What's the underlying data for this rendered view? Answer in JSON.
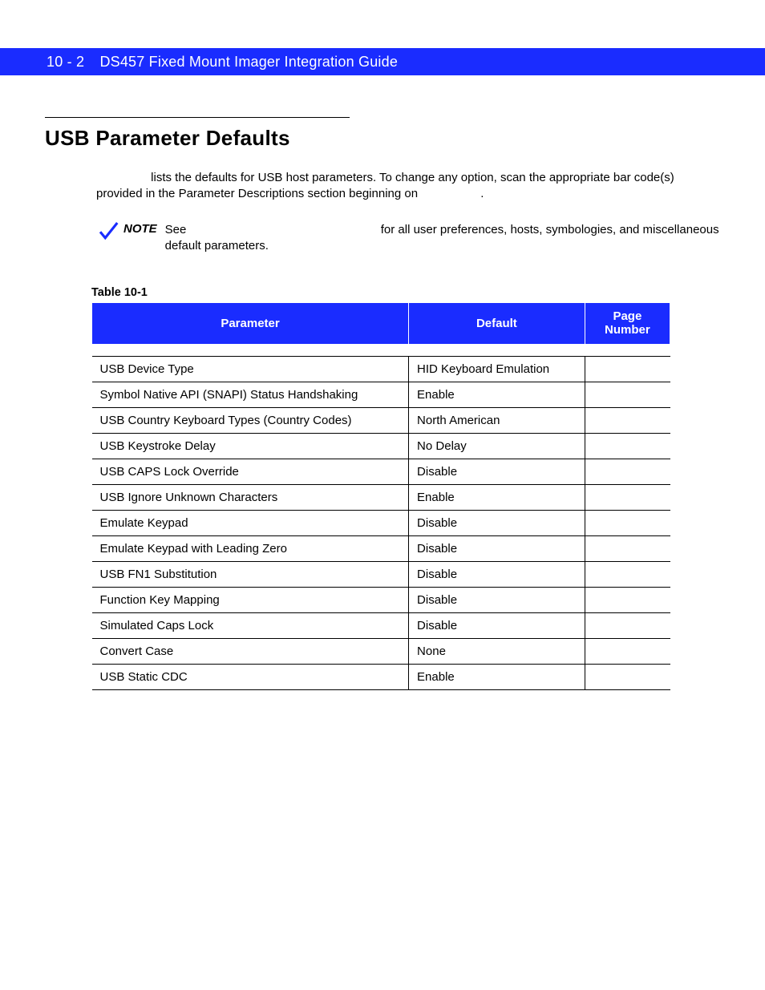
{
  "header": {
    "page_number": "10 - 2",
    "title": "DS457 Fixed Mount Imager Integration Guide"
  },
  "section_title": "USB Parameter Defaults",
  "intro": {
    "prefix_space": "",
    "text_before_link": " lists the defaults for USB host parameters. To change any option, scan the appropriate bar code(s) provided in the Parameter Descriptions section beginning on ",
    "text_after": "."
  },
  "note": {
    "label": "NOTE",
    "see": "See",
    "body_tail": "for all user preferences, hosts, symbologies, and miscellaneous default parameters."
  },
  "table_caption": "Table 10-1",
  "columns": {
    "parameter": "Parameter",
    "default": "Default",
    "page_number": "Page Number"
  },
  "section_row": "",
  "rows": [
    {
      "parameter": "USB Device Type",
      "default": "HID Keyboard Emulation",
      "page": ""
    },
    {
      "parameter": "Symbol Native API (SNAPI) Status Handshaking",
      "default": "Enable",
      "page": ""
    },
    {
      "parameter": "USB Country Keyboard Types (Country Codes)",
      "default": "North American",
      "page": ""
    },
    {
      "parameter": "USB Keystroke Delay",
      "default": "No Delay",
      "page": ""
    },
    {
      "parameter": "USB CAPS Lock Override",
      "default": "Disable",
      "page": ""
    },
    {
      "parameter": "USB Ignore Unknown Characters",
      "default": "Enable",
      "page": ""
    },
    {
      "parameter": "Emulate Keypad",
      "default": "Disable",
      "page": ""
    },
    {
      "parameter": "Emulate Keypad with Leading Zero",
      "default": "Disable",
      "page": ""
    },
    {
      "parameter": "USB FN1 Substitution",
      "default": "Disable",
      "page": ""
    },
    {
      "parameter": "Function Key Mapping",
      "default": "Disable",
      "page": ""
    },
    {
      "parameter": "Simulated Caps Lock",
      "default": "Disable",
      "page": ""
    },
    {
      "parameter": "Convert Case",
      "default": "None",
      "page": ""
    },
    {
      "parameter": "USB Static CDC",
      "default": "Enable",
      "page": ""
    }
  ]
}
